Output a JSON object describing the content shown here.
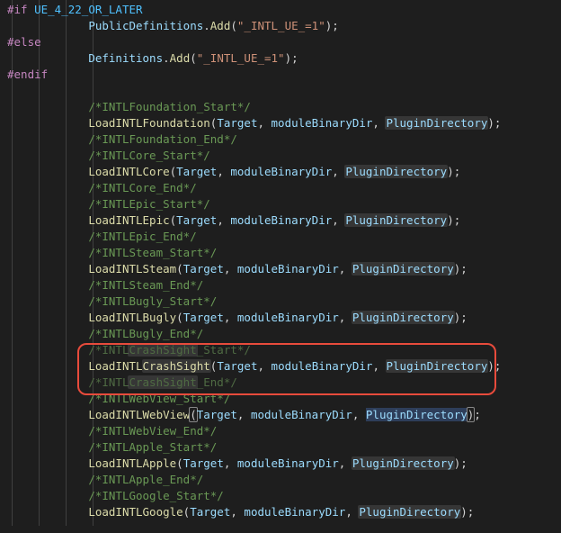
{
  "preproc": {
    "if": "#if",
    "cond": "UE_4_22_OR_LATER",
    "else": "#else",
    "endif": "#endif"
  },
  "pubdef": {
    "obj": "PublicDefinitions",
    "fn": "Add",
    "arg": "\"_INTL_UE_=1\"",
    "tail": ");"
  },
  "def": {
    "obj": "Definitions",
    "fn": "Add",
    "arg": "\"_INTL_UE_=1\"",
    "tail": ");"
  },
  "comments": {
    "foundation_s": "/*INTLFoundation_Start*/",
    "foundation_e": "/*INTLFoundation_End*/",
    "core_s": "/*INTLCore_Start*/",
    "core_e": "/*INTLCore_End*/",
    "epic_s": "/*INTLEpic_Start*/",
    "epic_e": "/*INTLEpic_End*/",
    "steam_s": "/*INTLSteam_Start*/",
    "steam_e": "/*INTLSteam_End*/",
    "bugly_s": "/*INTLBugly_Start*/",
    "bugly_e": "/*INTLBugly_End*/",
    "crash_s_pre": "/*INTL",
    "crash_s_mid": "CrashSight",
    "crash_s_suf": "_Start*/",
    "crash_e_pre": "/*INTL",
    "crash_e_mid": "CrashSight",
    "crash_e_suf": "_End*/",
    "webview_s": "/*INTLWebView_Start*/",
    "webview_e": "/*INTLWebView_End*/",
    "apple_s": "/*INTLApple_Start*/",
    "apple_e": "/*INTLApple_End*/",
    "google_s": "/*INTLGoogle_Start*/"
  },
  "calls": {
    "foundation": "LoadINTLFoundation",
    "core": "LoadINTLCore",
    "epic": "LoadINTLEpic",
    "steam": "LoadINTLSteam",
    "bugly": "LoadINTLBugly",
    "crash_pre": "LoadINTL",
    "crash_mid": "CrashSight",
    "webview": "LoadINTLWebView",
    "apple": "LoadINTLApple",
    "google": "LoadINTLGoogle"
  },
  "args": {
    "open": "(",
    "target": "Target",
    "sep": ", ",
    "binDir": "moduleBinaryDir",
    "plugDir": "PluginDirectory",
    "close": ");"
  }
}
